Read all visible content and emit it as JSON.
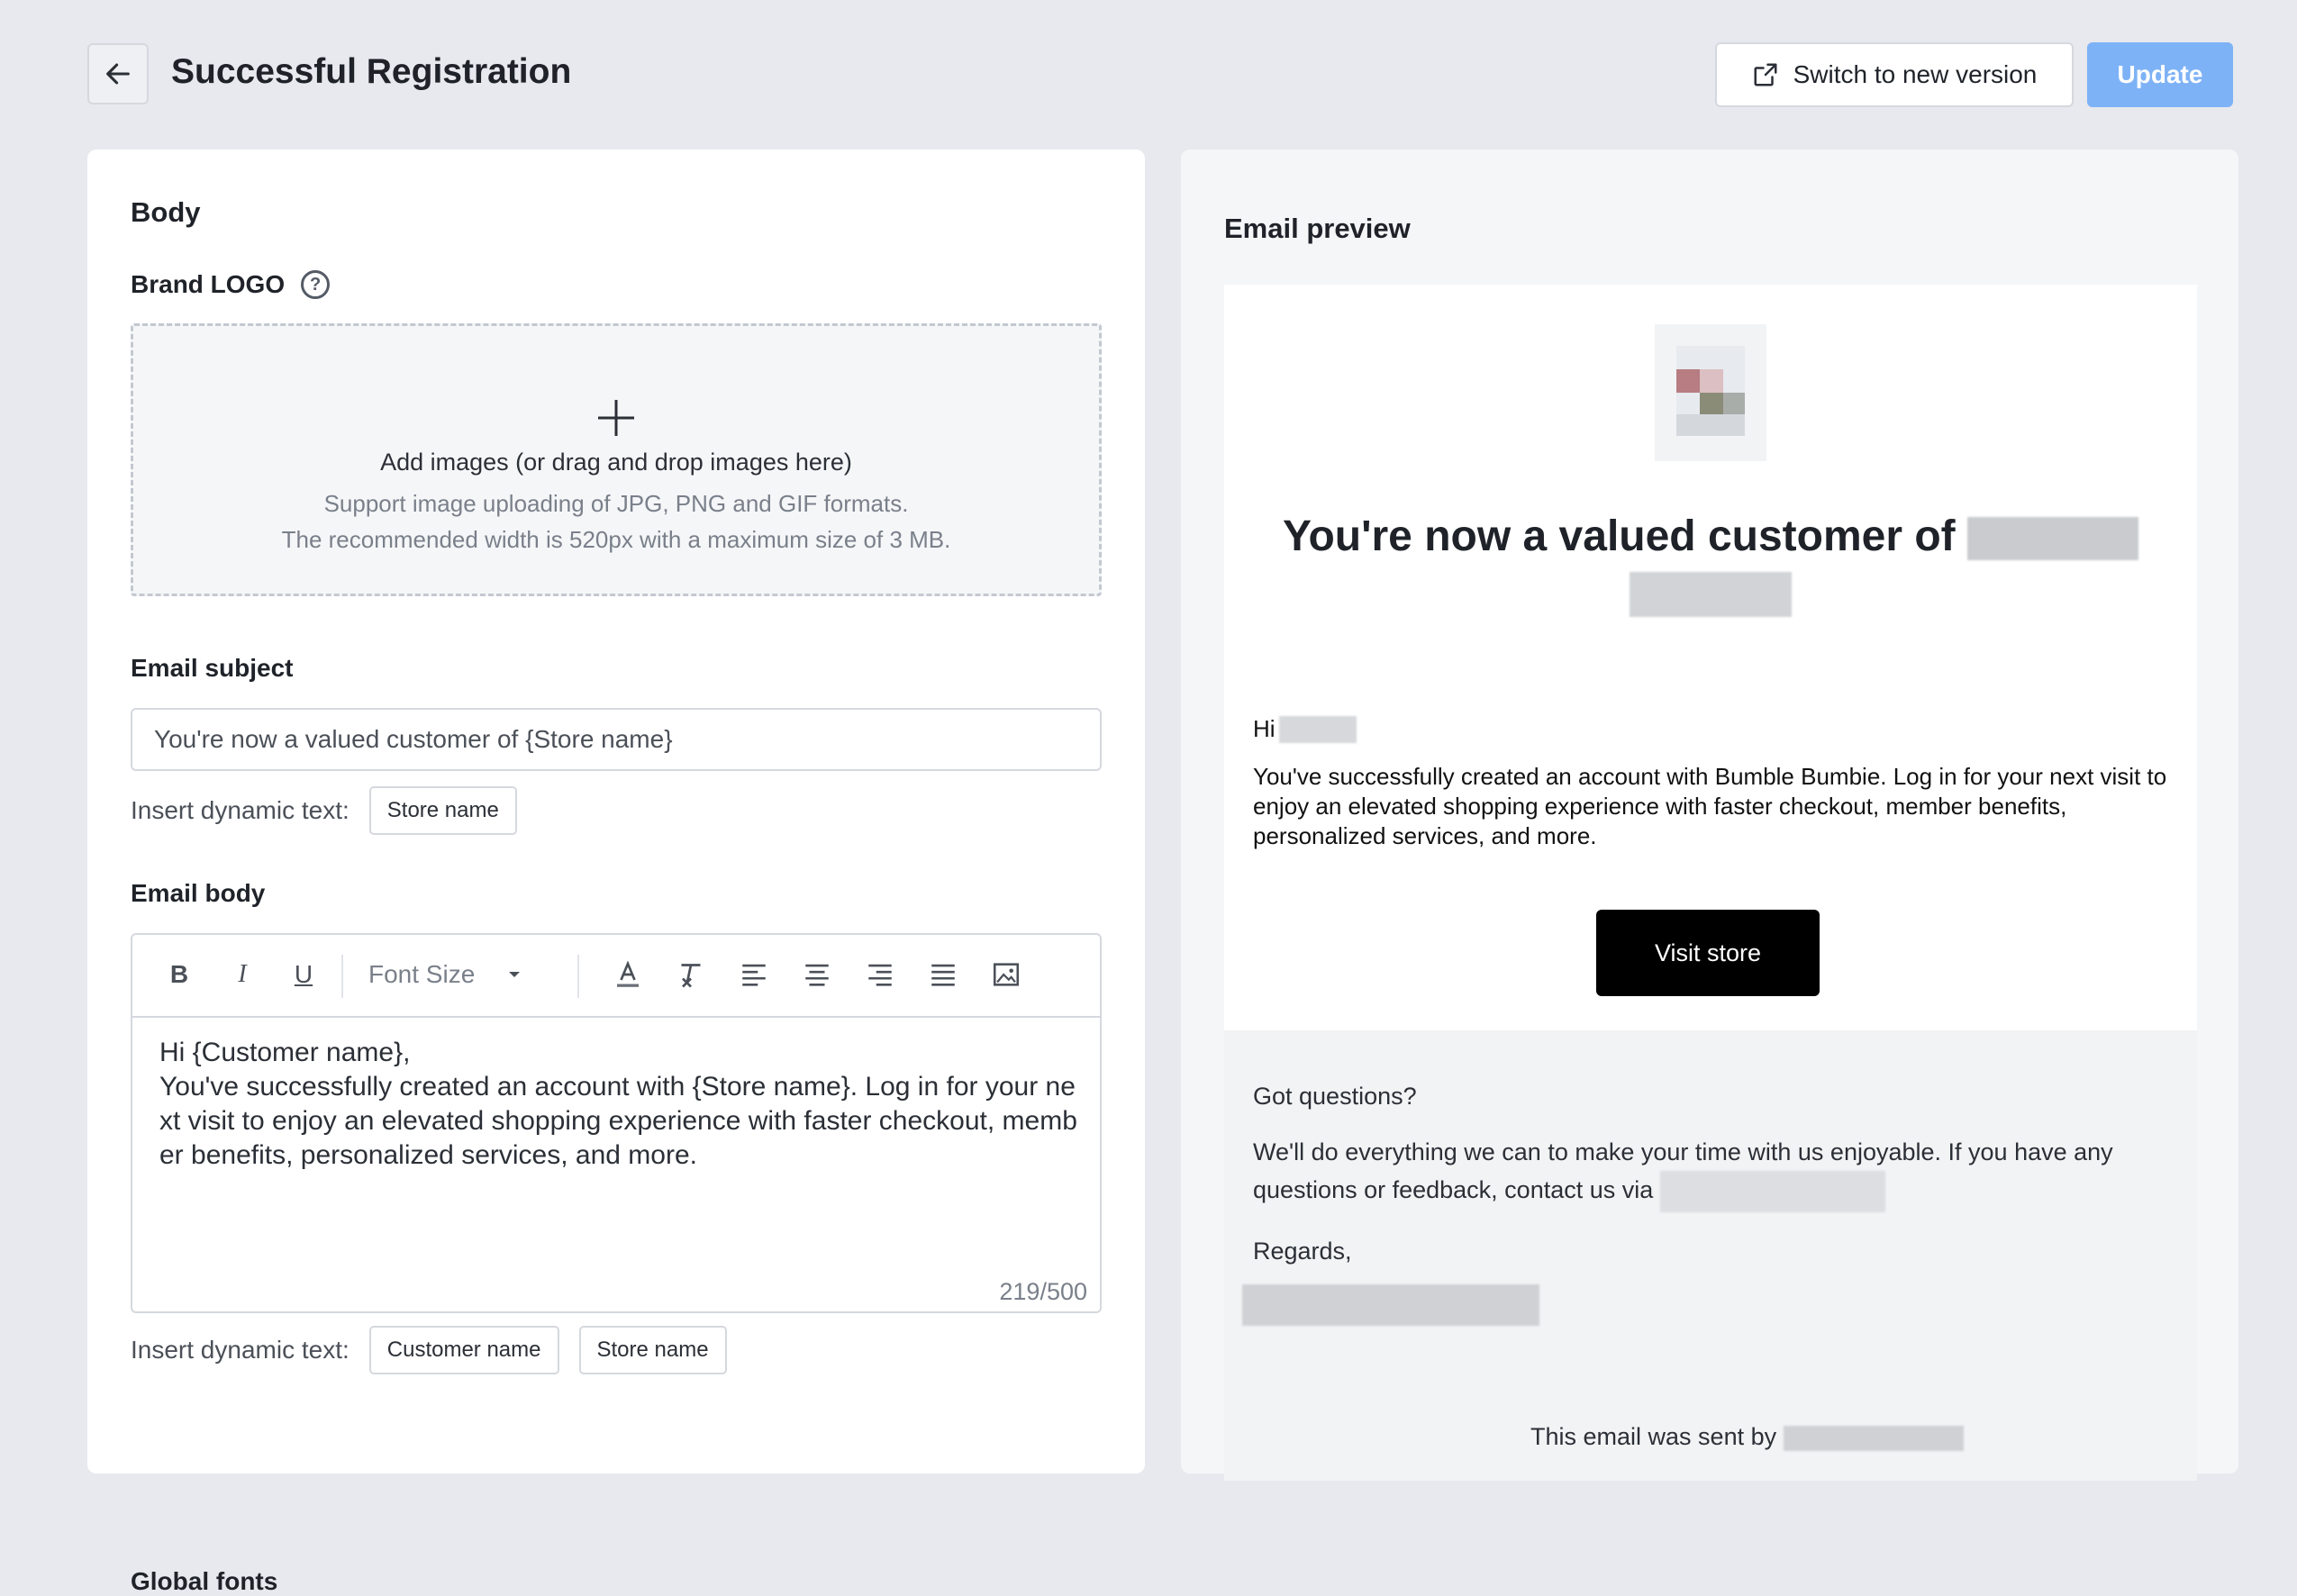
{
  "header": {
    "title": "Successful Registration",
    "switch_label": "Switch to new version",
    "update_label": "Update"
  },
  "left": {
    "section_title": "Body",
    "brand_logo_label": "Brand LOGO",
    "upload": {
      "main": "Add images (or drag and drop images here)",
      "line1": "Support image uploading of JPG, PNG and GIF formats.",
      "line2": "The recommended width is 520px with a maximum size of 3 MB."
    },
    "subject": {
      "label": "Email subject",
      "value": "You're now a valued customer of {Store name}",
      "insert_label": "Insert dynamic text:",
      "chips": [
        "Store name"
      ]
    },
    "body": {
      "label": "Email body",
      "font_size_label": "Font Size",
      "text": "Hi {Customer name},\nYou've successfully created an account with {Store name}. Log in for your next visit to enjoy an elevated shopping experience with faster checkout, member benefits, personalized services, and more.",
      "counter": "219/500",
      "insert_label": "Insert dynamic text:",
      "chips": [
        "Customer name",
        "Store name"
      ]
    },
    "global_fonts_label": "Global fonts"
  },
  "preview": {
    "title": "Email preview",
    "heading": "You're now a valued customer of",
    "hi": "Hi",
    "body": "You've successfully created an account with Bumble Bumbie. Log in for your next visit to enjoy an elevated shopping experience with faster checkout, member benefits, personalized services, and more.",
    "button": "Visit store",
    "questions": "Got questions?",
    "questions_body": "We'll do everything we can to make your time with us enjoyable. If you have any questions or feedback, contact us via",
    "regards": "Regards,",
    "sent_by": "This email was sent by"
  },
  "colors": {
    "background": "#e7e9ee",
    "update_button": "#7eb2f6",
    "visit_button": "#000000"
  }
}
